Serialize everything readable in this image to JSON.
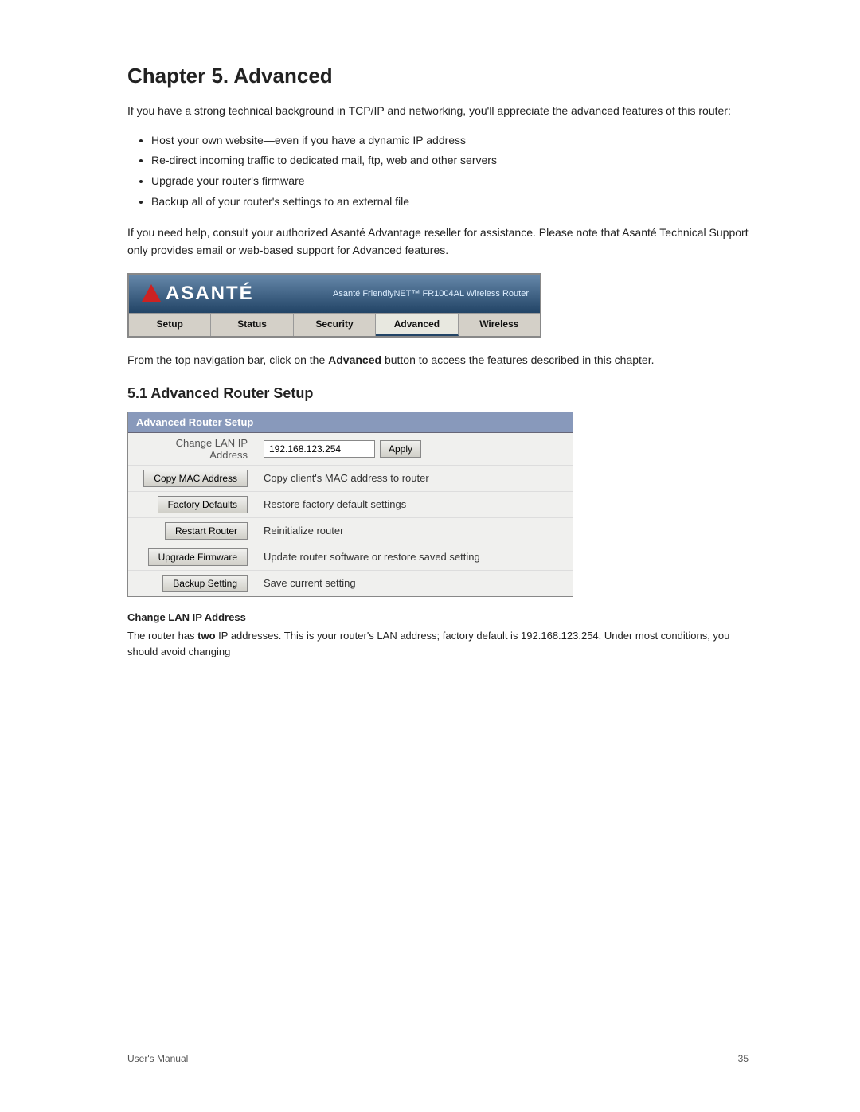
{
  "chapter": {
    "title": "Chapter 5. Advanced"
  },
  "intro": {
    "paragraph1": "If you have a strong technical background in TCP/IP and networking, you'll appreciate the advanced features of this router:",
    "bullets": [
      "Host your own website—even if you have a dynamic IP address",
      "Re-direct incoming traffic to dedicated mail, ftp, web and other servers",
      "Upgrade your router's firmware",
      "Backup all of your router's settings to an external file"
    ],
    "paragraph2": "If you need help, consult your authorized Asanté Advantage reseller for assistance. Please note that Asanté Technical Support only provides email or web-based support for Advanced features."
  },
  "router_ui": {
    "logo_text": "ASANTÉ",
    "model_text": "Asanté FriendlyNET™ FR1004AL Wireless Router",
    "nav_buttons": [
      "Setup",
      "Status",
      "Security",
      "Advanced",
      "Wireless"
    ]
  },
  "from_nav_para": "From the top navigation bar, click on the Advanced button to access the features described in this chapter.",
  "section51": {
    "title": "5.1 Advanced Router Setup",
    "box_title": "Advanced Router Setup",
    "rows": [
      {
        "label": "Change LAN IP Address",
        "input_value": "192.168.123.254",
        "has_apply": true,
        "apply_label": "Apply",
        "description": ""
      },
      {
        "label": "Copy MAC Address",
        "button_label": "Copy MAC Address",
        "description": "Copy client's MAC address to router"
      },
      {
        "label": "",
        "button_label": "Factory Defaults",
        "description": "Restore factory default settings"
      },
      {
        "label": "",
        "button_label": "Restart Router",
        "description": "Reinitialize router"
      },
      {
        "label": "",
        "button_label": "Upgrade Firmware",
        "description": "Update router software or restore saved setting"
      },
      {
        "label": "",
        "button_label": "Backup Setting",
        "description": "Save current setting"
      }
    ]
  },
  "change_lan": {
    "title": "Change LAN IP Address",
    "text_before_bold": "The router has ",
    "bold_text": "two",
    "text_after_bold": " IP addresses. This is your router's LAN address; factory default is 192.168.123.254. Under most conditions, you should avoid changing"
  },
  "footer": {
    "left": "User's Manual",
    "right": "35"
  }
}
